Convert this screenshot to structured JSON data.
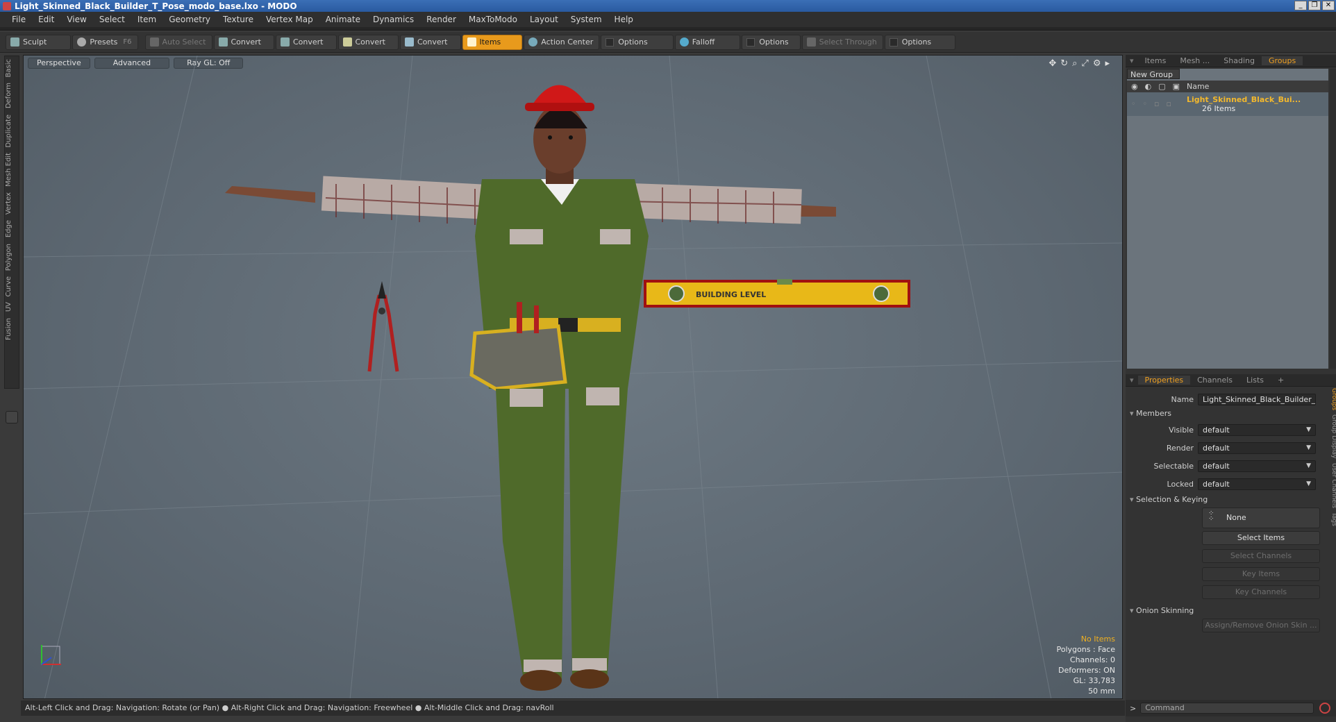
{
  "window": {
    "title": "Light_Skinned_Black_Builder_T_Pose_modo_base.lxo - MODO",
    "controls": [
      "_",
      "❐",
      "✕"
    ]
  },
  "menu": [
    "File",
    "Edit",
    "View",
    "Select",
    "Item",
    "Geometry",
    "Texture",
    "Vertex Map",
    "Animate",
    "Dynamics",
    "Render",
    "MaxToModo",
    "Layout",
    "System",
    "Help"
  ],
  "toolbar": {
    "sculpt": "Sculpt",
    "presets": "Presets",
    "presets_key": "F6",
    "auto_select": "Auto Select",
    "convert1": "Convert",
    "convert2": "Convert",
    "convert3": "Convert",
    "convert4": "Convert",
    "items": "Items",
    "action_center": "Action Center",
    "options1": "Options",
    "falloff": "Falloff",
    "options2": "Options",
    "select_through": "Select Through",
    "options3": "Options"
  },
  "left_tabs": [
    "Basic",
    "Deform",
    "Duplicate",
    "Mesh Edit",
    "Vertex",
    "Edge",
    "Polygon",
    "Curve",
    "UV",
    "Fusion"
  ],
  "viewport": {
    "view_mode": "Perspective",
    "shading": "Advanced",
    "raygl": "Ray GL: Off",
    "icons": [
      "✥",
      "↻",
      "⌕",
      "⤢",
      "⚙",
      "▸"
    ],
    "level_text": "BUILDING LEVEL",
    "info": {
      "selection": "No Items",
      "polygons": "Polygons : Face",
      "channels": "Channels: 0",
      "deformers": "Deformers: ON",
      "gl": "GL: 33,783",
      "scale": "50 mm"
    }
  },
  "status": "Alt-Left Click and Drag: Navigation: Rotate (or Pan) ● Alt-Right Click and Drag: Navigation: Freewheel ● Alt-Middle Click and Drag: navRoll",
  "groups_panel": {
    "tabs": [
      "Items",
      "Mesh ...",
      "Shading",
      "Groups"
    ],
    "new_group": "New Group",
    "name_col": "Name",
    "group_name": "Light_Skinned_Black_Bui...",
    "group_count": "26 Items"
  },
  "props_panel": {
    "tabs": [
      "Properties",
      "Channels",
      "Lists",
      "+"
    ],
    "name_label": "Name",
    "name_value": "Light_Skinned_Black_Builder_T_P",
    "members": "Members",
    "visible_label": "Visible",
    "visible_value": "default",
    "render_label": "Render",
    "render_value": "default",
    "selectable_label": "Selectable",
    "selectable_value": "default",
    "locked_label": "Locked",
    "locked_value": "default",
    "sel_keying": "Selection & Keying",
    "none": "None",
    "select_items": "Select Items",
    "select_channels": "Select Channels",
    "key_items": "Key Items",
    "key_channels": "Key Channels",
    "onion": "Onion Skinning",
    "assign_onion": "Assign/Remove Onion Skin ...",
    "side_tabs": [
      "Groups",
      "Group Display",
      "User Channels",
      "Tags"
    ]
  },
  "command": {
    "prompt": ">",
    "placeholder": "Command"
  }
}
